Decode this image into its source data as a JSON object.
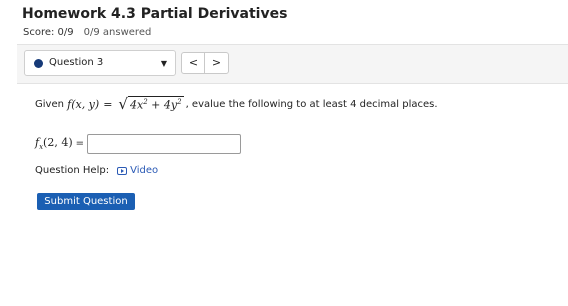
{
  "header": {
    "title": "Homework 4.3 Partial Derivatives",
    "score": "Score: 0/9",
    "answered": "0/9 answered"
  },
  "nav": {
    "question_label": "Question 3",
    "prev_label": "<",
    "next_label": ">"
  },
  "question": {
    "given": "Given",
    "func_lhs": "f(x, y)",
    "equals": "=",
    "radicand_a": "4x",
    "radicand_op": " + 4y",
    "sup": "2",
    "trailing": ", evalue the following to at least 4 decimal places.",
    "part_label": "f",
    "part_sub": "x",
    "part_args": "(2, 4)",
    "part_eq": "=",
    "answer_value": ""
  },
  "help": {
    "label": "Question Help:",
    "video": "Video"
  },
  "submit": {
    "label": "Submit Question"
  },
  "colors": {
    "accent": "#1b5fb3",
    "dot": "#163a78",
    "link": "#2b5ab5"
  }
}
